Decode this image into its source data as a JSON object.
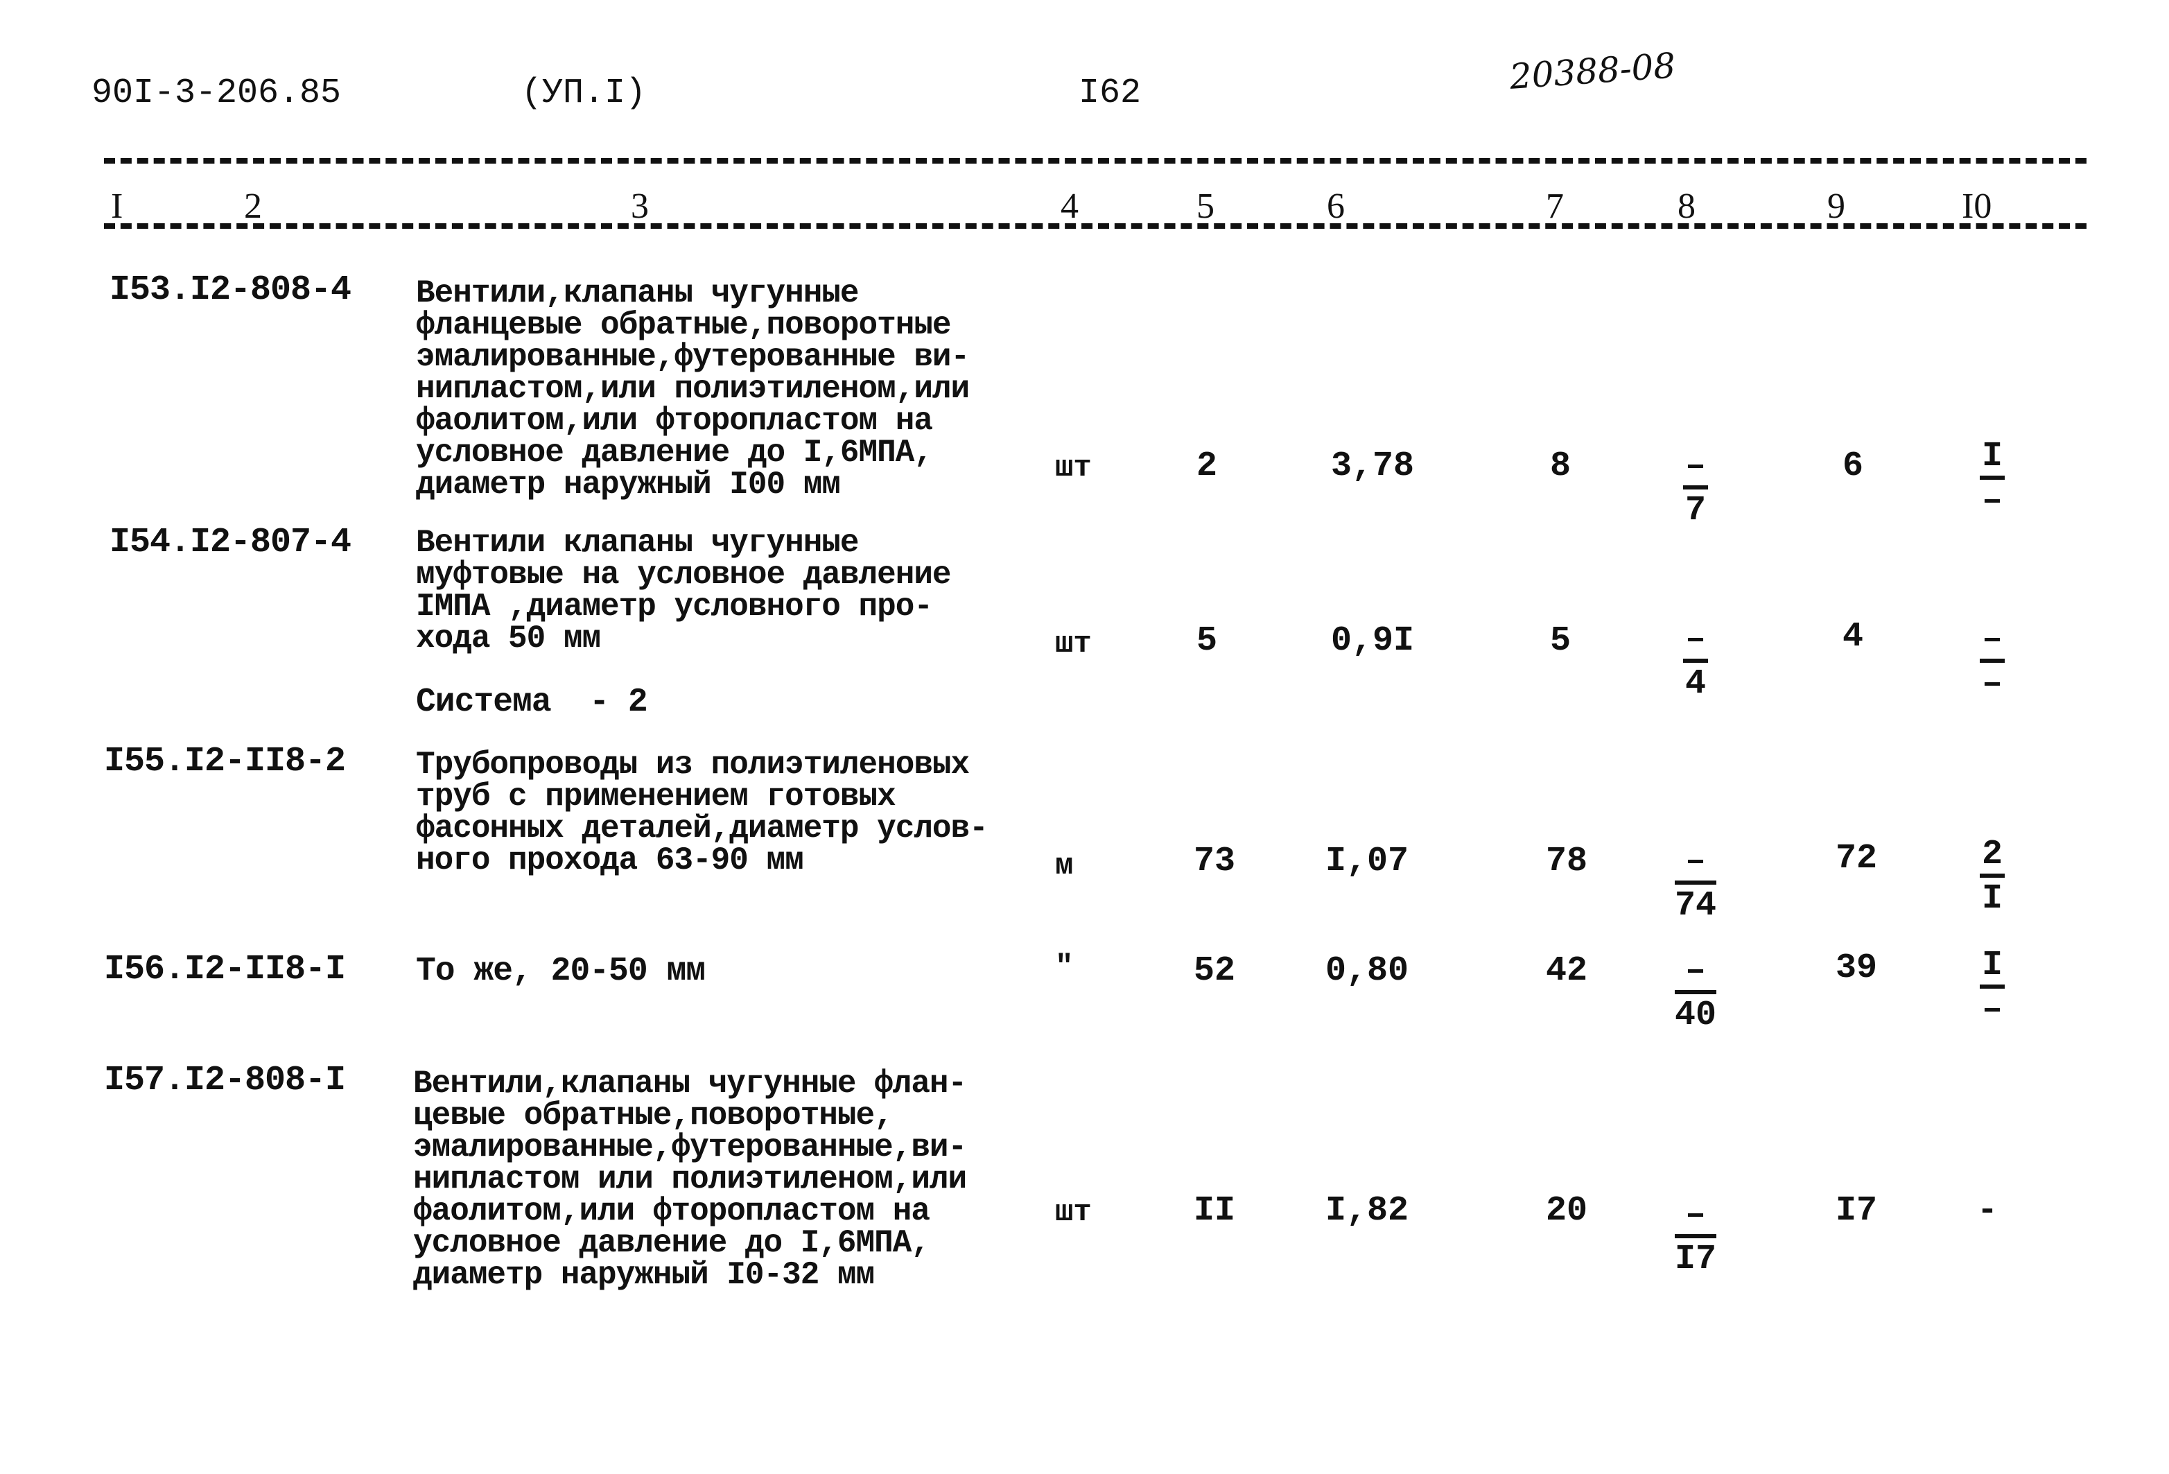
{
  "header": {
    "doc_code": "90I-3-206.85",
    "section": "(УП.I)",
    "page_number": "I62",
    "stamp_number": "20388-08"
  },
  "columns": [
    "I",
    "2",
    "3",
    "4",
    "5",
    "6",
    "7",
    "8",
    "9",
    "I0"
  ],
  "rows": [
    {
      "code": "I53.I2-808-4",
      "description": "Вентили,клапаны чугунные\nфланцевые обратные,поворотные\nэмалированные,футерованные ви-\nнипластом,или полиэтиленом,или\nфаолитом,или фторопластом на\nусловное давление до I,6МПА,\nдиаметр наружный I00 мм",
      "unit": "шт",
      "col5": "2",
      "col6": "3,78",
      "col7": "8",
      "col8": {
        "numerator": "–",
        "denominator": "7"
      },
      "col9": "6",
      "col10": {
        "numerator": "I",
        "denominator": "–"
      }
    },
    {
      "code": "I54.I2-807-4",
      "description": "Вентили клапаны чугунные\nмуфтовые на условное давление\nIМПА ,диаметр условного про-\nхода 50 мм",
      "unit": "шт",
      "col5": "5",
      "col6": "0,9I",
      "col7": "5",
      "col8": {
        "numerator": "–",
        "denominator": "4"
      },
      "col9": "4",
      "col10": {
        "numerator": "–",
        "denominator": "–"
      }
    },
    {
      "section_label": "Система  - 2"
    },
    {
      "code": "I55.I2-II8-2",
      "description": "Трубопроводы из полиэтиленовых\nтруб с применением готовых\nфасонных деталей,диаметр услов-\nного прохода 63-90 мм",
      "unit": "м",
      "col5": "73",
      "col6": "I,07",
      "col7": "78",
      "col8": {
        "numerator": "–",
        "denominator": "74"
      },
      "col9": "72",
      "col10": {
        "numerator": "2",
        "denominator": "I"
      }
    },
    {
      "code": "I56.I2-II8-I",
      "description": "То же, 20-50 мм",
      "unit": "\"",
      "col5": "52",
      "col6": "0,80",
      "col7": "42",
      "col8": {
        "numerator": "–",
        "denominator": "40"
      },
      "col9": "39",
      "col10": {
        "numerator": "I",
        "denominator": "–"
      }
    },
    {
      "code": "I57.I2-808-I",
      "description": "Вентили,клапаны чугунные флан-\nцевые обратные,поворотные,\nэмалированные,футерованные,ви-\nнипластом или полиэтиленом,или\nфаолитом,или фторопластом на\nусловное давление до I,6МПА,\nдиаметр наружный I0-32 мм",
      "unit": "шт",
      "col5": "II",
      "col6": "I,82",
      "col7": "20",
      "col8": {
        "numerator": "–",
        "denominator": "I7"
      },
      "col9": "I7",
      "col10": "-"
    }
  ]
}
